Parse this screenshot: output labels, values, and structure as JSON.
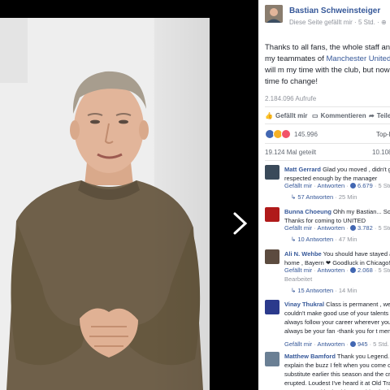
{
  "post": {
    "page_name": "Bastian Schweinsteiger",
    "audience": "Diese Seite gefällt mir",
    "time": "5 Std.",
    "text_part1": "Thanks to all fans, the whole staff and my teammates of ",
    "text_link": "Manchester United",
    "text_part2": "! I will m my time with the club, but now it's time fo change!",
    "views": "2.184.096 Aufrufe"
  },
  "actions": {
    "like": "Gefällt mir",
    "comment": "Kommentieren",
    "share": "Teile"
  },
  "reactions": {
    "count": "145.996",
    "top_label": "Top-K",
    "shared": "19.124 Mal geteilt",
    "comment_count": "10.108"
  },
  "comments": [
    {
      "name": "Matt Gerrard",
      "text": "Glad you moved , didn't g respected enough by the manager",
      "like": "Gefällt mir",
      "reply": "Antworten",
      "likes": "6.679",
      "time": "5 Std.",
      "replies": "57 Antworten",
      "replies_time": "25 Min",
      "avatar_color": "#3a4a5a"
    },
    {
      "name": "Bunna Choeung",
      "text": "Ohh my Bastian... Sor Thanks for coming to UNITED",
      "like": "Gefällt mir",
      "reply": "Antworten",
      "likes": "3.782",
      "time": "5 Std.",
      "replies": "10 Antworten",
      "replies_time": "47 Min",
      "avatar_color": "#b01a1a"
    },
    {
      "name": "Ali N. Wehbe",
      "text": "You should have stayed a home , Bayern ❤ Goodluck in Chicago!",
      "like": "Gefällt mir",
      "reply": "Antworten",
      "likes": "2.068",
      "time": "5 Std.",
      "edited": "Bearbeitet",
      "replies": "15 Antworten",
      "replies_time": "14 Min",
      "avatar_color": "#5c4b3f"
    },
    {
      "name": "Vinay Thukral",
      "text": "Class is permanent , we j couldn't make good use of your talents always follow your career wherever you shall always be your fan -thank you for t memories",
      "like": "Gefällt mir",
      "reply": "Antworten",
      "likes": "945",
      "time": "5 Std.",
      "avatar_color": "#2b3a8c"
    },
    {
      "name": "Matthew Bamford",
      "text": "Thank you Legend. I explain the buzz I felt when you come on substitute earlier this season and the cr erupted. Loudest I've heard it at Old Tra season. Good luck with everything in the",
      "avatar_color": "#6a7f94"
    }
  ]
}
